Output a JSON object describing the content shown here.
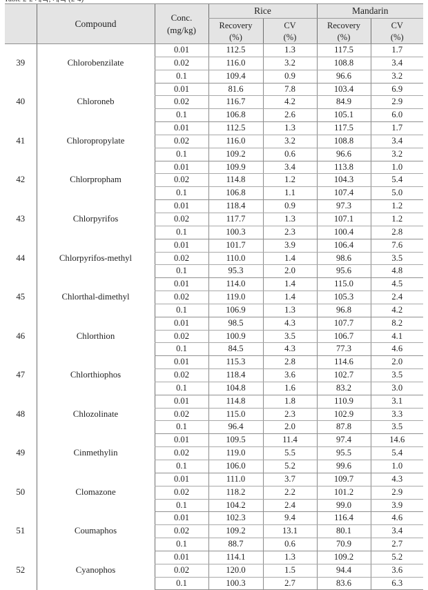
{
  "caption_fragment": "Table 2-2  계속, 계속  (2-4)",
  "table": {
    "header": {
      "no_label": "",
      "compound_label": "Compound",
      "conc_label_line1": "Conc.",
      "conc_label_line2": "(mg/kg)",
      "groups": [
        {
          "name": "Rice",
          "sub": [
            {
              "line1": "Recovery",
              "line2": "(%)"
            },
            {
              "line1": "CV",
              "line2": "(%)"
            }
          ]
        },
        {
          "name": "Mandarin",
          "sub": [
            {
              "line1": "Recovery",
              "line2": "(%)"
            },
            {
              "line1": "CV",
              "line2": "(%)"
            }
          ]
        }
      ]
    },
    "rows": [
      {
        "no": "39",
        "compound": "Chlorobenzilate",
        "levels": [
          {
            "conc": "0.01",
            "rice_recovery": "112.5",
            "rice_cv": "1.3",
            "mandarin_recovery": "117.5",
            "mandarin_cv": "1.7"
          },
          {
            "conc": "0.02",
            "rice_recovery": "116.0",
            "rice_cv": "3.2",
            "mandarin_recovery": "108.8",
            "mandarin_cv": "3.4"
          },
          {
            "conc": "0.1",
            "rice_recovery": "109.4",
            "rice_cv": "0.9",
            "mandarin_recovery": "96.6",
            "mandarin_cv": "3.2"
          }
        ]
      },
      {
        "no": "40",
        "compound": "Chloroneb",
        "levels": [
          {
            "conc": "0.01",
            "rice_recovery": "81.6",
            "rice_cv": "7.8",
            "mandarin_recovery": "103.4",
            "mandarin_cv": "6.9"
          },
          {
            "conc": "0.02",
            "rice_recovery": "116.7",
            "rice_cv": "4.2",
            "mandarin_recovery": "84.9",
            "mandarin_cv": "2.9"
          },
          {
            "conc": "0.1",
            "rice_recovery": "106.8",
            "rice_cv": "2.6",
            "mandarin_recovery": "105.1",
            "mandarin_cv": "6.0"
          }
        ]
      },
      {
        "no": "41",
        "compound": "Chloropropylate",
        "levels": [
          {
            "conc": "0.01",
            "rice_recovery": "112.5",
            "rice_cv": "1.3",
            "mandarin_recovery": "117.5",
            "mandarin_cv": "1.7"
          },
          {
            "conc": "0.02",
            "rice_recovery": "116.0",
            "rice_cv": "3.2",
            "mandarin_recovery": "108.8",
            "mandarin_cv": "3.4"
          },
          {
            "conc": "0.1",
            "rice_recovery": "109.2",
            "rice_cv": "0.6",
            "mandarin_recovery": "96.6",
            "mandarin_cv": "3.2"
          }
        ]
      },
      {
        "no": "42",
        "compound": "Chlorpropham",
        "levels": [
          {
            "conc": "0.01",
            "rice_recovery": "109.9",
            "rice_cv": "3.4",
            "mandarin_recovery": "113.8",
            "mandarin_cv": "1.0"
          },
          {
            "conc": "0.02",
            "rice_recovery": "114.8",
            "rice_cv": "1.2",
            "mandarin_recovery": "104.3",
            "mandarin_cv": "5.4"
          },
          {
            "conc": "0.1",
            "rice_recovery": "106.8",
            "rice_cv": "1.1",
            "mandarin_recovery": "107.4",
            "mandarin_cv": "5.0"
          }
        ]
      },
      {
        "no": "43",
        "compound": "Chlorpyrifos",
        "levels": [
          {
            "conc": "0.01",
            "rice_recovery": "118.4",
            "rice_cv": "0.9",
            "mandarin_recovery": "97.3",
            "mandarin_cv": "1.2"
          },
          {
            "conc": "0.02",
            "rice_recovery": "117.7",
            "rice_cv": "1.3",
            "mandarin_recovery": "107.1",
            "mandarin_cv": "1.2"
          },
          {
            "conc": "0.1",
            "rice_recovery": "100.3",
            "rice_cv": "2.3",
            "mandarin_recovery": "100.4",
            "mandarin_cv": "2.8"
          }
        ]
      },
      {
        "no": "44",
        "compound": "Chlorpyrifos-methyl",
        "levels": [
          {
            "conc": "0.01",
            "rice_recovery": "101.7",
            "rice_cv": "3.9",
            "mandarin_recovery": "106.4",
            "mandarin_cv": "7.6"
          },
          {
            "conc": "0.02",
            "rice_recovery": "110.0",
            "rice_cv": "1.4",
            "mandarin_recovery": "98.6",
            "mandarin_cv": "3.5"
          },
          {
            "conc": "0.1",
            "rice_recovery": "95.3",
            "rice_cv": "2.0",
            "mandarin_recovery": "95.6",
            "mandarin_cv": "4.8"
          }
        ]
      },
      {
        "no": "45",
        "compound": "Chlorthal-dimethyl",
        "levels": [
          {
            "conc": "0.01",
            "rice_recovery": "114.0",
            "rice_cv": "1.4",
            "mandarin_recovery": "115.0",
            "mandarin_cv": "4.5"
          },
          {
            "conc": "0.02",
            "rice_recovery": "119.0",
            "rice_cv": "1.4",
            "mandarin_recovery": "105.3",
            "mandarin_cv": "2.4"
          },
          {
            "conc": "0.1",
            "rice_recovery": "106.9",
            "rice_cv": "1.3",
            "mandarin_recovery": "96.8",
            "mandarin_cv": "4.2"
          }
        ]
      },
      {
        "no": "46",
        "compound": "Chlorthion",
        "levels": [
          {
            "conc": "0.01",
            "rice_recovery": "98.5",
            "rice_cv": "4.3",
            "mandarin_recovery": "107.7",
            "mandarin_cv": "8.2"
          },
          {
            "conc": "0.02",
            "rice_recovery": "100.9",
            "rice_cv": "3.5",
            "mandarin_recovery": "106.7",
            "mandarin_cv": "4.1"
          },
          {
            "conc": "0.1",
            "rice_recovery": "84.5",
            "rice_cv": "4.3",
            "mandarin_recovery": "77.3",
            "mandarin_cv": "4.6"
          }
        ]
      },
      {
        "no": "47",
        "compound": "Chlorthiophos",
        "levels": [
          {
            "conc": "0.01",
            "rice_recovery": "115.3",
            "rice_cv": "2.8",
            "mandarin_recovery": "114.6",
            "mandarin_cv": "2.0"
          },
          {
            "conc": "0.02",
            "rice_recovery": "118.4",
            "rice_cv": "3.6",
            "mandarin_recovery": "102.7",
            "mandarin_cv": "3.5"
          },
          {
            "conc": "0.1",
            "rice_recovery": "104.8",
            "rice_cv": "1.6",
            "mandarin_recovery": "83.2",
            "mandarin_cv": "3.0"
          }
        ]
      },
      {
        "no": "48",
        "compound": "Chlozolinate",
        "levels": [
          {
            "conc": "0.01",
            "rice_recovery": "114.8",
            "rice_cv": "1.8",
            "mandarin_recovery": "110.9",
            "mandarin_cv": "3.1"
          },
          {
            "conc": "0.02",
            "rice_recovery": "115.0",
            "rice_cv": "2.3",
            "mandarin_recovery": "102.9",
            "mandarin_cv": "3.3"
          },
          {
            "conc": "0.1",
            "rice_recovery": "96.4",
            "rice_cv": "2.0",
            "mandarin_recovery": "87.8",
            "mandarin_cv": "3.5"
          }
        ]
      },
      {
        "no": "49",
        "compound": "Cinmethylin",
        "levels": [
          {
            "conc": "0.01",
            "rice_recovery": "109.5",
            "rice_cv": "11.4",
            "mandarin_recovery": "97.4",
            "mandarin_cv": "14.6"
          },
          {
            "conc": "0.02",
            "rice_recovery": "119.0",
            "rice_cv": "5.5",
            "mandarin_recovery": "95.5",
            "mandarin_cv": "5.4"
          },
          {
            "conc": "0.1",
            "rice_recovery": "106.0",
            "rice_cv": "5.2",
            "mandarin_recovery": "99.6",
            "mandarin_cv": "1.0"
          }
        ]
      },
      {
        "no": "50",
        "compound": "Clomazone",
        "levels": [
          {
            "conc": "0.01",
            "rice_recovery": "111.0",
            "rice_cv": "3.7",
            "mandarin_recovery": "109.7",
            "mandarin_cv": "4.3"
          },
          {
            "conc": "0.02",
            "rice_recovery": "118.2",
            "rice_cv": "2.2",
            "mandarin_recovery": "101.2",
            "mandarin_cv": "2.9"
          },
          {
            "conc": "0.1",
            "rice_recovery": "104.2",
            "rice_cv": "2.4",
            "mandarin_recovery": "99.0",
            "mandarin_cv": "3.9"
          }
        ]
      },
      {
        "no": "51",
        "compound": "Coumaphos",
        "levels": [
          {
            "conc": "0.01",
            "rice_recovery": "102.3",
            "rice_cv": "9.4",
            "mandarin_recovery": "116.4",
            "mandarin_cv": "4.6"
          },
          {
            "conc": "0.02",
            "rice_recovery": "109.2",
            "rice_cv": "13.1",
            "mandarin_recovery": "80.1",
            "mandarin_cv": "3.4"
          },
          {
            "conc": "0.1",
            "rice_recovery": "88.7",
            "rice_cv": "0.6",
            "mandarin_recovery": "70.9",
            "mandarin_cv": "2.7"
          }
        ]
      },
      {
        "no": "52",
        "compound": "Cyanophos",
        "levels": [
          {
            "conc": "0.01",
            "rice_recovery": "114.1",
            "rice_cv": "1.3",
            "mandarin_recovery": "109.2",
            "mandarin_cv": "5.2"
          },
          {
            "conc": "0.02",
            "rice_recovery": "120.0",
            "rice_cv": "1.5",
            "mandarin_recovery": "94.4",
            "mandarin_cv": "3.6"
          },
          {
            "conc": "0.1",
            "rice_recovery": "100.3",
            "rice_cv": "2.7",
            "mandarin_recovery": "83.6",
            "mandarin_cv": "6.3"
          }
        ]
      }
    ]
  }
}
